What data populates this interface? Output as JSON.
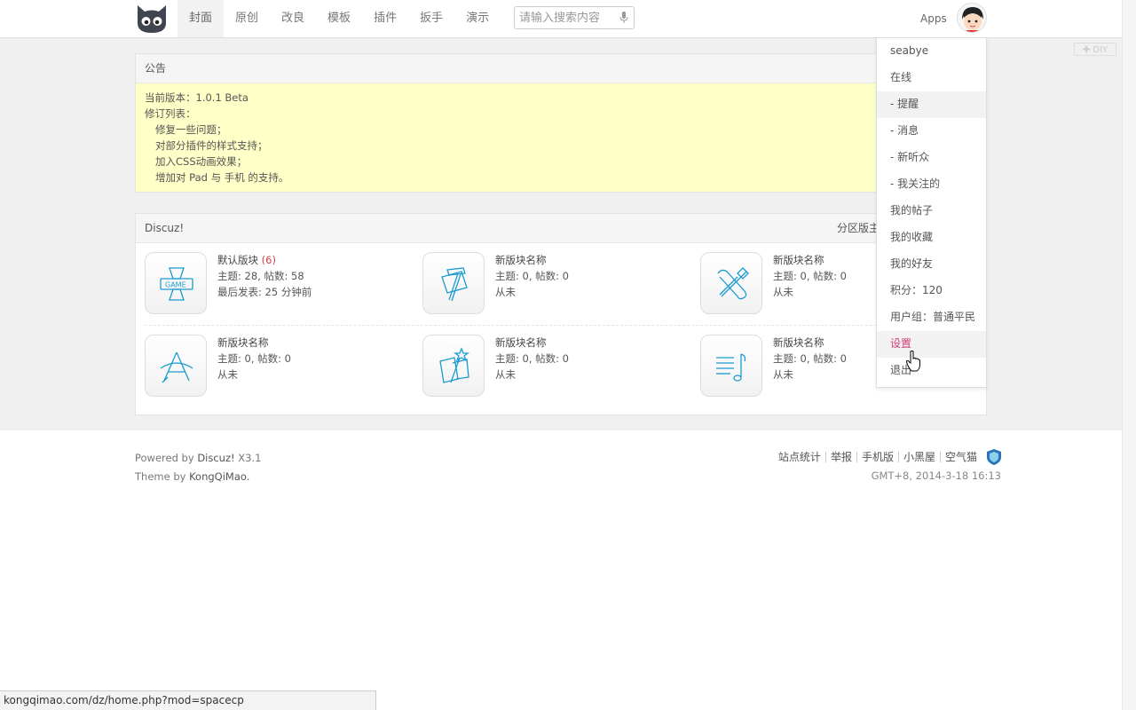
{
  "nav": {
    "items": [
      {
        "label": "封面",
        "active": true
      },
      {
        "label": "原创"
      },
      {
        "label": "改良"
      },
      {
        "label": "模板"
      },
      {
        "label": "插件"
      },
      {
        "label": "扳手"
      },
      {
        "label": "演示"
      }
    ]
  },
  "search": {
    "placeholder": "请输入搜索内容"
  },
  "header": {
    "apps_label": "Apps",
    "diy_label": "✚ DIY"
  },
  "notice": {
    "title": "公告",
    "lines": [
      {
        "text": "当前版本：1.0.1 Beta",
        "indent": false
      },
      {
        "text": "修订列表：",
        "indent": false
      },
      {
        "text": "修复一些问题；",
        "indent": true
      },
      {
        "text": "对部分插件的样式支持；",
        "indent": true
      },
      {
        "text": "加入CSS动画效果；",
        "indent": true
      },
      {
        "text": "增加对 Pad 与 手机 的支持。",
        "indent": true
      }
    ]
  },
  "forum_section": {
    "title": "Discuz!",
    "moderator_label": "分区版主",
    "forums": [
      {
        "name": "默认版块",
        "count": "(6)",
        "stats": "主题: 28, 帖数: 58",
        "last": "最后发表: 25 分钟前",
        "icon": "game-icon"
      },
      {
        "name": "新版块名称",
        "count": "",
        "stats": "主题: 0, 帖数: 0",
        "last": "从未",
        "icon": "hammer-icon"
      },
      {
        "name": "新版块名称",
        "count": "",
        "stats": "主题: 0, 帖数: 0",
        "last": "从未",
        "icon": "tools-icon"
      },
      {
        "name": "新版块名称",
        "count": "",
        "stats": "主题: 0, 帖数: 0",
        "last": "从未",
        "icon": "design-icon"
      },
      {
        "name": "新版块名称",
        "count": "",
        "stats": "主题: 0, 帖数: 0",
        "last": "从未",
        "icon": "magic-icon"
      },
      {
        "name": "新版块名称",
        "count": "",
        "stats": "主题: 0, 帖数: 0",
        "last": "从未",
        "icon": "music-icon"
      }
    ]
  },
  "user_menu": {
    "items": [
      {
        "label": "seabye"
      },
      {
        "label": "在线"
      },
      {
        "label": "- 提醒",
        "highlight": true
      },
      {
        "label": "- 消息"
      },
      {
        "label": "- 新听众"
      },
      {
        "label": "- 我关注的"
      },
      {
        "label": "我的帖子"
      },
      {
        "label": "我的收藏"
      },
      {
        "label": "我的好友"
      },
      {
        "label": "积分：120"
      },
      {
        "label": "用户组：普通平民"
      },
      {
        "label": "设置",
        "highlight": true,
        "accent": true
      },
      {
        "label": "退出"
      }
    ]
  },
  "footer": {
    "powered_prefix": "Powered by ",
    "powered_brand": "Discuz!",
    "powered_version": " X3.1",
    "theme_prefix": "Theme by ",
    "theme_brand": "KongQiMao.",
    "links": [
      "站点统计",
      "举报",
      "手机版",
      "小黑屋",
      "空气猫"
    ],
    "time": "GMT+8, 2014-3-18 16:13"
  },
  "status_bar": {
    "url": "kongqimao.com/dz/home.php?mod=spacecp"
  },
  "colors": {
    "accent": "#d23b78",
    "notice_bg": "#ffffc8",
    "icon_stroke": "#1a9bd0"
  }
}
